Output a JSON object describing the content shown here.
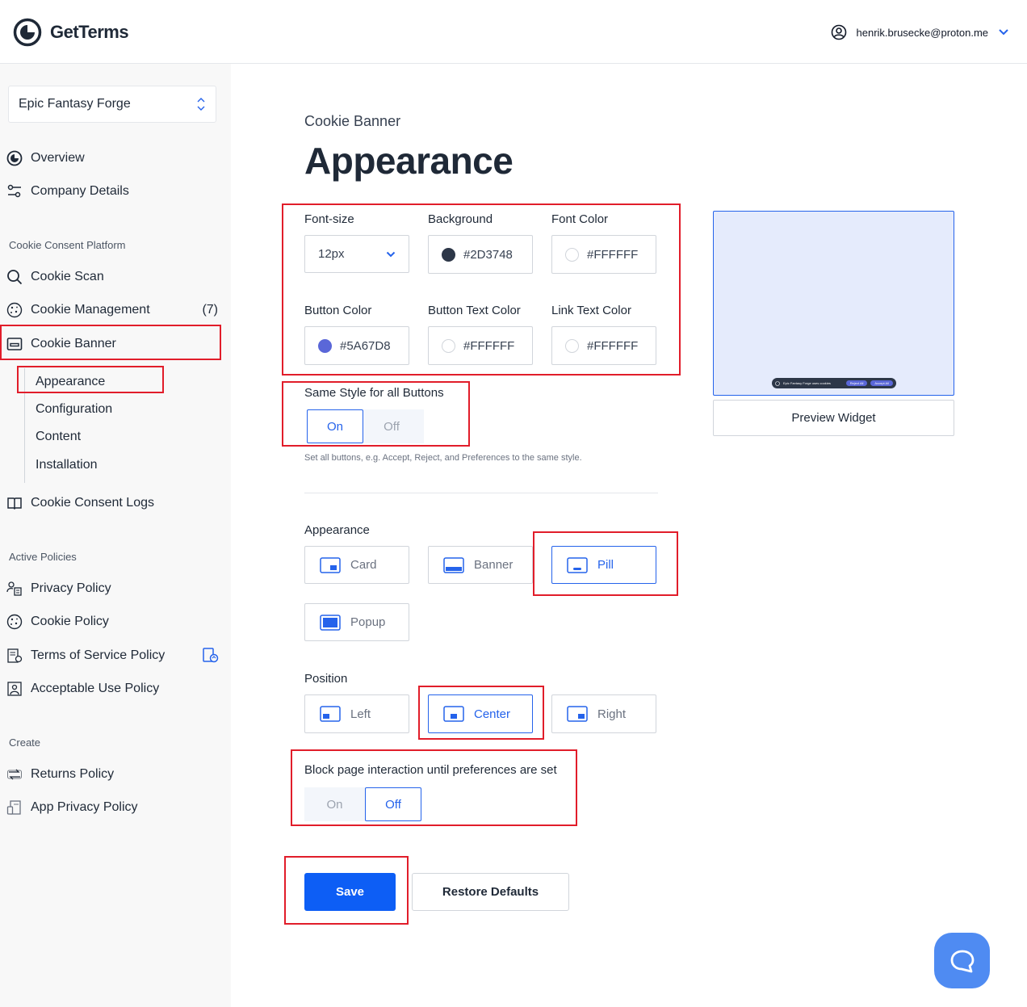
{
  "header": {
    "brand": "GetTerms",
    "user_email": "henrik.brusecke@proton.me"
  },
  "sidebar": {
    "project": "Epic Fantasy Forge",
    "top_items": [
      {
        "label": "Overview",
        "icon": "overview-icon"
      },
      {
        "label": "Company Details",
        "icon": "sliders-icon"
      }
    ],
    "sections": {
      "ccp": "Cookie Consent Platform",
      "active": "Active Policies",
      "create": "Create"
    },
    "ccp_items": {
      "cookie_scan": "Cookie Scan",
      "cookie_management": "Cookie Management",
      "cookie_management_count": "(7)",
      "cookie_banner": "Cookie Banner",
      "cookie_consent_logs": "Cookie Consent Logs"
    },
    "banner_subitems": [
      "Appearance",
      "Configuration",
      "Content",
      "Installation"
    ],
    "active_items": [
      "Privacy Policy",
      "Cookie Policy",
      "Terms of Service Policy",
      "Acceptable Use Policy"
    ],
    "create_items": [
      "Returns Policy",
      "App Privacy Policy"
    ]
  },
  "main": {
    "breadcrumb": "Cookie Banner",
    "title": "Appearance",
    "fields": {
      "font_size": {
        "label": "Font-size",
        "value": "12px"
      },
      "background": {
        "label": "Background",
        "value": "#2D3748",
        "color": "#2D3748"
      },
      "font_color": {
        "label": "Font Color",
        "value": "#FFFFFF",
        "color": "#FFFFFF"
      },
      "button_color": {
        "label": "Button Color",
        "value": "#5A67D8",
        "color": "#5A67D8"
      },
      "button_text_color": {
        "label": "Button Text Color",
        "value": "#FFFFFF",
        "color": "#FFFFFF"
      },
      "link_text_color": {
        "label": "Link Text Color",
        "value": "#FFFFFF",
        "color": "#FFFFFF"
      }
    },
    "same_style": {
      "label": "Same Style for all Buttons",
      "on": "On",
      "off": "Off",
      "selected": "On",
      "help": "Set all buttons, e.g. Accept, Reject, and Preferences to the same style."
    },
    "appearance": {
      "label": "Appearance",
      "options": [
        "Card",
        "Banner",
        "Pill",
        "Popup"
      ],
      "selected": "Pill"
    },
    "position": {
      "label": "Position",
      "options": [
        "Left",
        "Center",
        "Right"
      ],
      "selected": "Center"
    },
    "block": {
      "label": "Block page interaction until preferences are set",
      "on": "On",
      "off": "Off",
      "selected": "Off"
    },
    "save": "Save",
    "restore": "Restore Defaults"
  },
  "preview": {
    "button": "Preview Widget",
    "pill_text": "Epic Fantasy Forge uses cookies",
    "reject": "Reject All",
    "accept": "Accept All"
  },
  "colors": {
    "accent": "#2563EB",
    "save_button": "#0D5EF5",
    "annotation": "#E11D2A"
  }
}
